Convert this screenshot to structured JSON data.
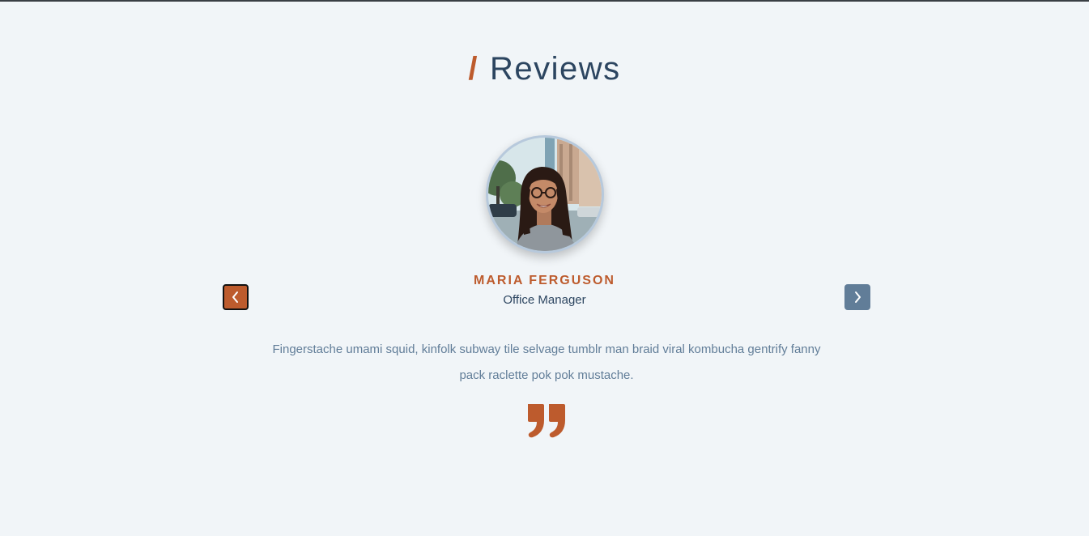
{
  "section": {
    "title_prefix": "/",
    "title": "Reviews"
  },
  "review": {
    "name": "MARIA FERGUSON",
    "job": "Office Manager",
    "text": "Fingerstache umami squid, kinfolk subway tile selvage tumblr man braid viral kombucha gentrify fanny pack raclette pok pok mustache."
  },
  "icons": {
    "prev": "chevron-left-icon",
    "next": "chevron-right-icon",
    "quote": "quote-right-icon"
  },
  "colors": {
    "accent": "#bd5b2d",
    "heading": "#2c4560",
    "text": "#617d98",
    "background": "#f1f5f8",
    "next_button": "#617d98"
  }
}
